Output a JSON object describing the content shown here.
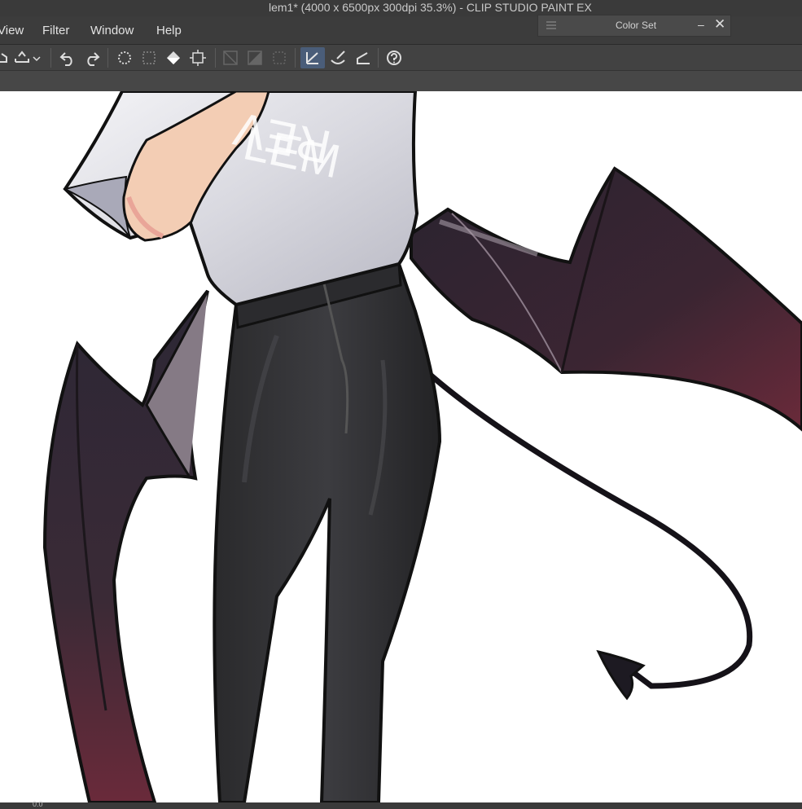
{
  "window": {
    "title": "lem1* (4000 x 6500px 300dpi 35.3%)  - CLIP STUDIO PAINT EX"
  },
  "menu": {
    "view": "View",
    "filter": "Filter",
    "window": "Window",
    "help": "Help"
  },
  "color_set_panel": {
    "title": "Color Set",
    "minimize": "–",
    "close": "✕"
  },
  "artwork": {
    "shirt_text_line1": "LEM",
    "shirt_text_line2": "REV"
  },
  "status": {
    "zoom_value": "0.0"
  },
  "icons": [
    "clear-icon",
    "fill-icon",
    "chevron-down-icon",
    "undo-icon",
    "redo-icon",
    "select-all-icon",
    "deselect-icon",
    "fill-bucket-icon",
    "transform-icon",
    "ruler-icon",
    "pen-icon",
    "brush-icon",
    "eraser-icon",
    "help-icon"
  ],
  "colors": {
    "chrome_dark": "#3a3a3a",
    "toolbar": "#424242",
    "active_tool": "#4a5d79",
    "wing_dark": "#2e2530",
    "wing_red": "#6a2a3a"
  }
}
